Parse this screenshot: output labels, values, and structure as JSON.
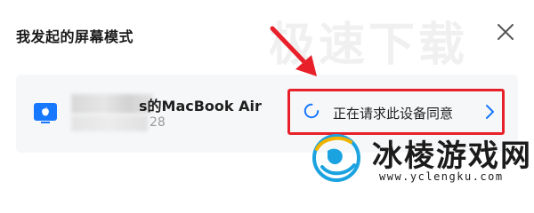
{
  "dialog": {
    "title": "我发起的屏幕模式"
  },
  "watermark": {
    "top_text": "极速下载",
    "brand": "冰棱游戏网",
    "url": "www.yclengku.com"
  },
  "device": {
    "name_suffix": "s的MacBook Air",
    "ip_suffix": "28"
  },
  "status": {
    "text": "正在请求此设备同意"
  },
  "colors": {
    "accent": "#1677ff",
    "highlight": "#e8202a"
  }
}
